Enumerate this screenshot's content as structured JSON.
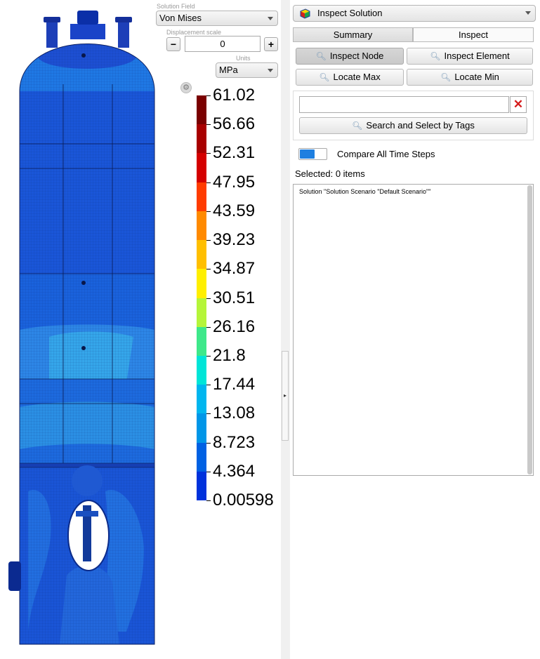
{
  "display": {
    "solution_field_label": "Solution Field",
    "solution_field_value": "Von Mises",
    "displacement_scale_label": "Displacement scale",
    "displacement_scale_value": "0",
    "minus_label": "−",
    "plus_label": "+",
    "units_label": "Units",
    "units_value": "MPa"
  },
  "legend": {
    "values": [
      "61.02",
      "56.66",
      "52.31",
      "47.95",
      "43.59",
      "39.23",
      "34.87",
      "30.51",
      "26.16",
      "21.8",
      "17.44",
      "13.08",
      "8.723",
      "4.364",
      "0.00598"
    ],
    "colors": [
      "#7a0000",
      "#a80000",
      "#d40000",
      "#ff3c00",
      "#ff8a00",
      "#ffbf00",
      "#ffef00",
      "#b5f53a",
      "#3ee88a",
      "#00e5d8",
      "#00b6ef",
      "#0096e8",
      "#0061e3",
      "#0032dc"
    ]
  },
  "panel": {
    "header_title": "Inspect Solution",
    "header_icon": "cube-icon",
    "tabs": [
      "Summary",
      "Inspect"
    ],
    "active_tab": "Inspect",
    "buttons": {
      "inspect_node": "Inspect Node",
      "inspect_element": "Inspect Element",
      "locate_max": "Locate Max",
      "locate_min": "Locate Min",
      "search_tags": "Search and Select by Tags"
    },
    "tag_search_value": "",
    "compare_label": "Compare All Time Steps",
    "compare_enabled": true,
    "selected_label": "Selected: 0 items",
    "results": [
      "Solution \"Solution Scenario \"Default Scenario\"\""
    ]
  }
}
